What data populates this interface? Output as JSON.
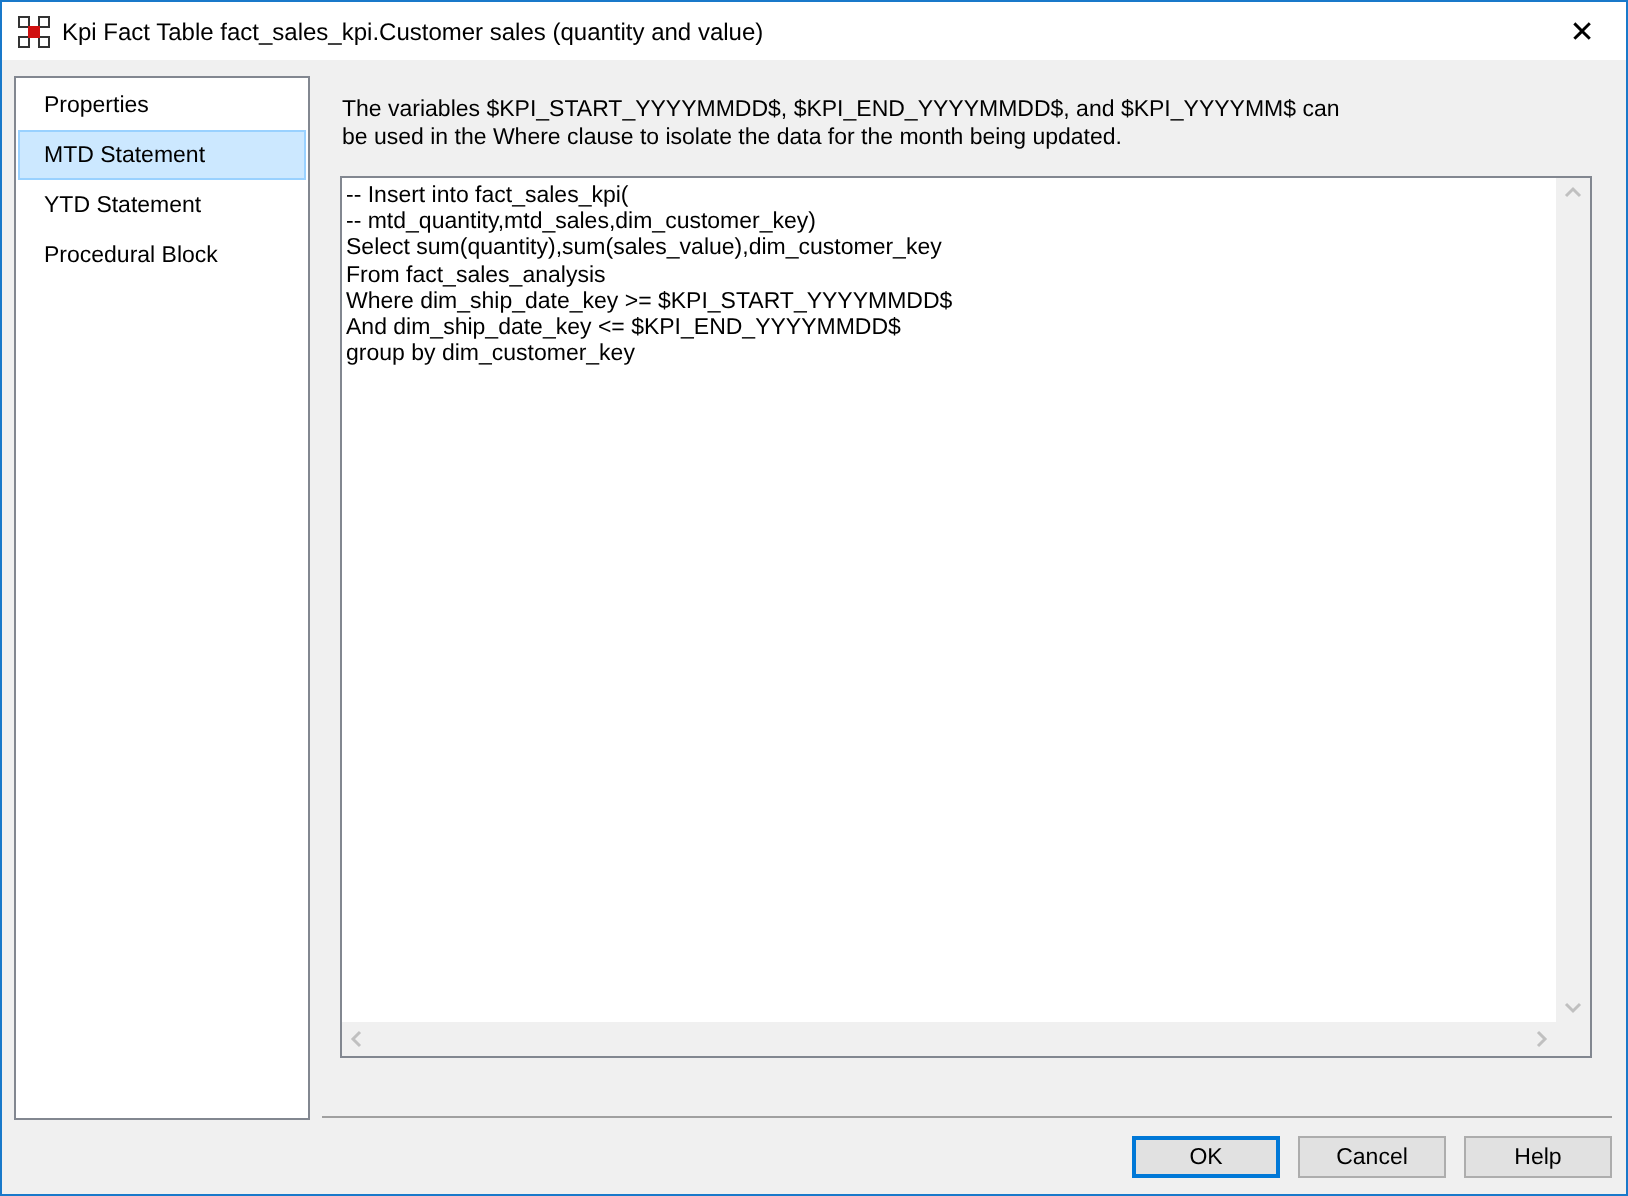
{
  "window": {
    "title": "Kpi Fact Table fact_sales_kpi.Customer sales (quantity and value)",
    "close": "✕"
  },
  "sidebar": {
    "items": [
      {
        "label": "Properties",
        "selected": false
      },
      {
        "label": "MTD Statement",
        "selected": true
      },
      {
        "label": "YTD Statement",
        "selected": false
      },
      {
        "label": "Procedural Block",
        "selected": false
      }
    ]
  },
  "description": "The variables $KPI_START_YYYYMMDD$, $KPI_END_YYYYMMDD$, and $KPI_YYYYMM$ can be used in the Where clause to isolate the data for the month being updated.",
  "editor": {
    "lines": [
      "-- Insert into fact_sales_kpi(",
      "-- mtd_quantity,mtd_sales,dim_customer_key)",
      "Select sum(quantity),sum(sales_value),dim_customer_key",
      "From fact_sales_analysis",
      "Where dim_ship_date_key >= $KPI_START_YYYYMMDD$",
      "And dim_ship_date_key <= $KPI_END_YYYYMMDD$",
      "group by dim_customer_key"
    ]
  },
  "buttons": [
    {
      "label": "OK",
      "default": true
    },
    {
      "label": "Cancel",
      "default": false
    },
    {
      "label": "Help",
      "default": false
    }
  ]
}
